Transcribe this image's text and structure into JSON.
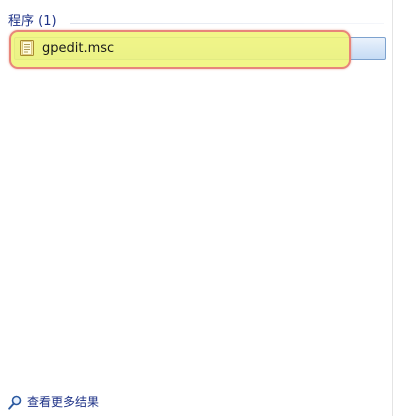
{
  "results": {
    "group_header": "程序 (1)",
    "items": [
      {
        "label": "gpedit.msc",
        "icon": "msc-file-icon",
        "selected": true
      }
    ]
  },
  "footer": {
    "see_more_label": "查看更多结果",
    "icon": "search-icon"
  },
  "colors": {
    "header_text": "#1e3287",
    "highlight_fill": "#f0f578",
    "highlight_border": "#e8857a",
    "selection_border": "#7da2ce"
  }
}
